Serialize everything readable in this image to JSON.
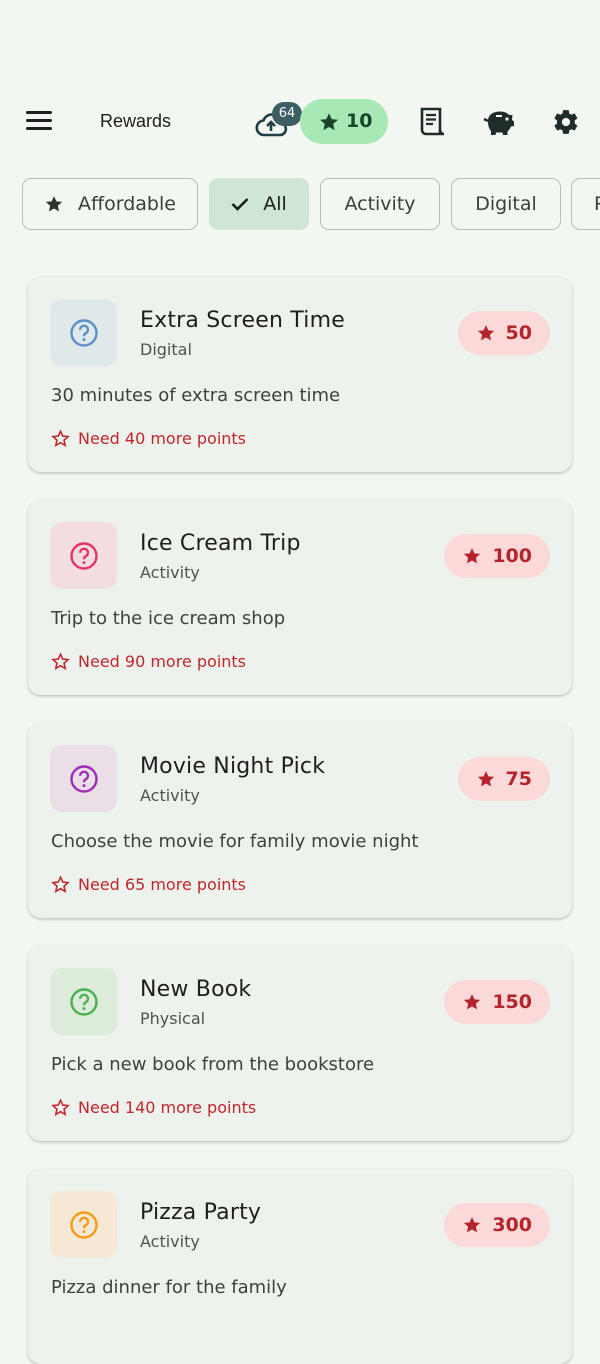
{
  "header": {
    "title": "Rewards",
    "sync_badge": "64",
    "points": "10",
    "icons": [
      "menu-icon",
      "cloud-upload-icon",
      "star-icon",
      "receipt-icon",
      "piggy-bank-icon",
      "gear-icon"
    ]
  },
  "filters": {
    "affordable": "Affordable",
    "all": "All",
    "activity": "Activity",
    "digital": "Digital",
    "physical": "P"
  },
  "rewards": [
    {
      "name": "Extra Screen Time",
      "category": "Digital",
      "cost": "50",
      "description": "30 minutes of extra screen time",
      "need": "Need 40 more points",
      "icon_color": "#5b8fc7",
      "icon_bg": "#e1e8ea"
    },
    {
      "name": "Ice Cream Trip",
      "category": "Activity",
      "cost": "100",
      "description": "Trip to the ice cream shop",
      "need": "Need 90 more points",
      "icon_color": "#e5306a",
      "icon_bg": "#f3dde0"
    },
    {
      "name": "Movie Night Pick",
      "category": "Activity",
      "cost": "75",
      "description": "Choose the movie for family movie night",
      "need": "Need 65 more points",
      "icon_color": "#9c2db6",
      "icon_bg": "#eadfe6"
    },
    {
      "name": "New Book",
      "category": "Physical",
      "cost": "150",
      "description": "Pick a new book from the bookstore",
      "need": "Need 140 more points",
      "icon_color": "#4caf50",
      "icon_bg": "#dcebda"
    },
    {
      "name": "Pizza Party",
      "category": "Activity",
      "cost": "300",
      "description": "Pizza dinner for the family",
      "need": "",
      "icon_color": "#f59a12",
      "icon_bg": "#f5e9d6"
    }
  ],
  "colors": {
    "background": "#f3f7f1",
    "points_pill": "#a8e8b4",
    "cost_pill": "#fbd9d9",
    "cost_text": "#b3242b",
    "selected_chip": "#cfe6d4"
  }
}
